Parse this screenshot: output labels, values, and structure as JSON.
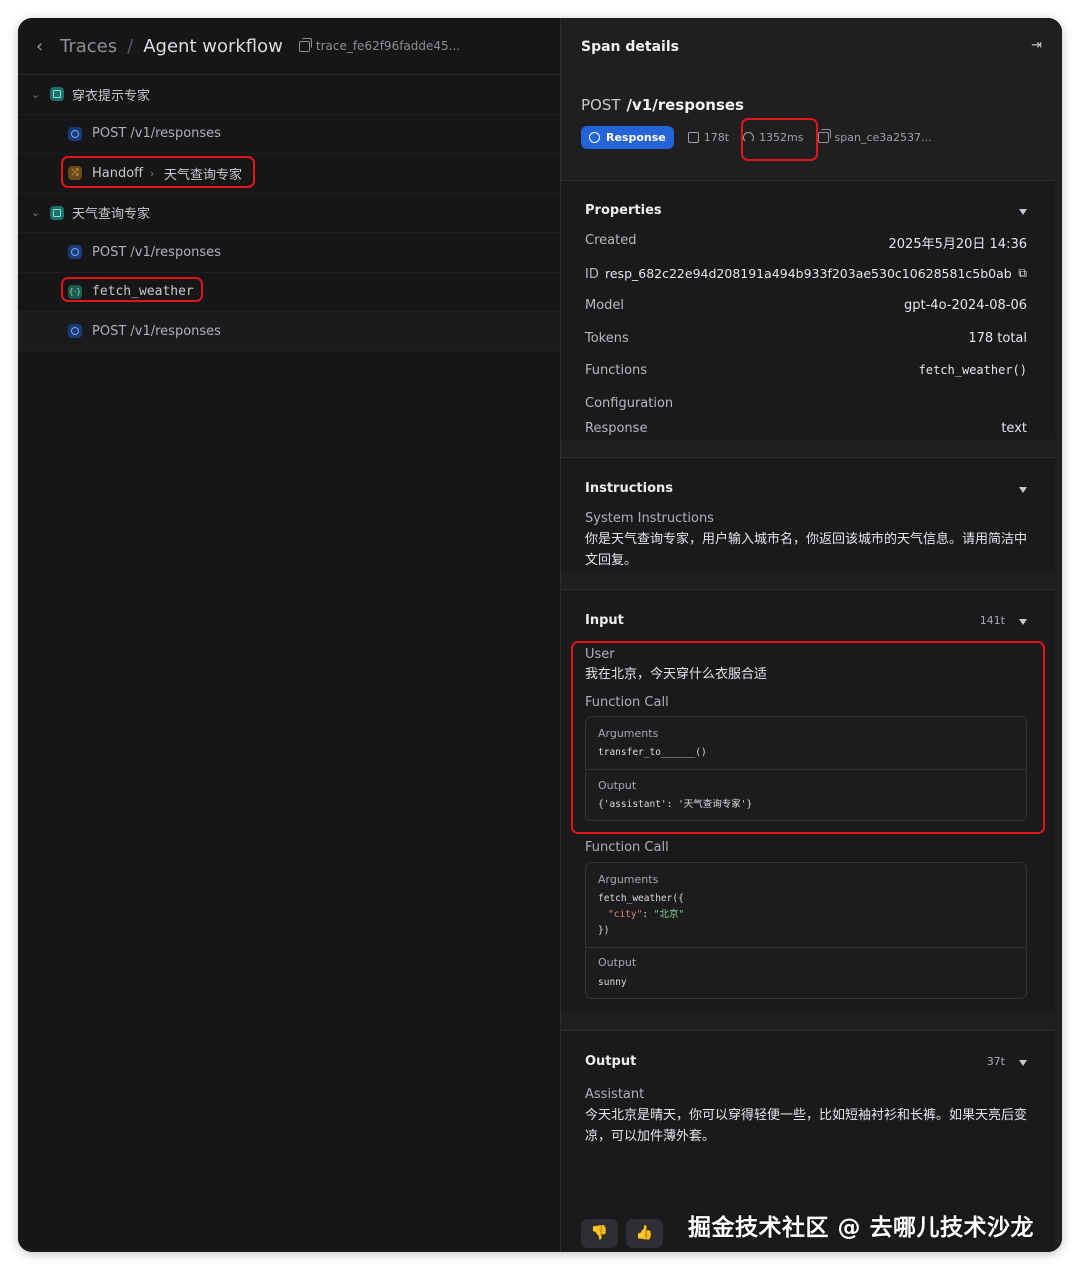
{
  "header": {
    "breadcrumb_root": "Traces",
    "breadcrumb_sep": "/",
    "breadcrumb_current": "Agent workflow",
    "trace_id": "trace_fe62f96fadde45..."
  },
  "tree": [
    {
      "type": "agent",
      "label": "穿衣提示专家"
    },
    {
      "type": "response",
      "label": "POST /v1/responses"
    },
    {
      "type": "handoff",
      "label_from": "Handoff",
      "arrow": "›",
      "label_to": "天气查询专家"
    },
    {
      "type": "agent",
      "label": "天气查询专家"
    },
    {
      "type": "response",
      "label": "POST /v1/responses"
    },
    {
      "type": "function",
      "label": "fetch_weather"
    },
    {
      "type": "response",
      "label": "POST /v1/responses"
    }
  ],
  "span": {
    "title": "Span details",
    "method": "POST",
    "path": "/v1/responses",
    "badge": "Response",
    "tokens": "178t",
    "duration": "1352ms",
    "span_id": "span_ce3a2537..."
  },
  "properties": {
    "title": "Properties",
    "created_label": "Created",
    "created_value": "2025年5月20日 14:36",
    "id_label": "ID",
    "id_value": "resp_682c22e94d208191a494b933f203ae530c10628581c5b0ab",
    "model_label": "Model",
    "model_value": "gpt-4o-2024-08-06",
    "tokens_label": "Tokens",
    "tokens_value": "178 total",
    "functions_label": "Functions",
    "functions_value": "fetch_weather()",
    "config_label": "Configuration",
    "response_label": "Response",
    "response_value": "text"
  },
  "instructions": {
    "title": "Instructions",
    "sub": "System Instructions",
    "text": "你是天气查询专家，用户输入城市名，你返回该城市的天气信息。请用简洁中文回复。"
  },
  "input": {
    "title": "Input",
    "tokens": "141t",
    "user_label": "User",
    "user_text": "我在北京，今天穿什么衣服合适",
    "fc1_label": "Function Call",
    "fc1_args_label": "Arguments",
    "fc1_args": "transfer_to______()",
    "fc1_output_label": "Output",
    "fc1_output": "{'assistant': '天气查询专家'}",
    "fc2_label": "Function Call",
    "fc2_args_label": "Arguments",
    "fc2_args_line1": "fetch_weather({",
    "fc2_args_key": "\"city\"",
    "fc2_args_colon": ": ",
    "fc2_args_val": "\"北京\"",
    "fc2_args_line3": "})",
    "fc2_output_label": "Output",
    "fc2_output": "sunny"
  },
  "output": {
    "title": "Output",
    "tokens": "37t",
    "role": "Assistant",
    "text": "今天北京是晴天，你可以穿得轻便一些，比如短袖衬衫和长裤。如果天亮后变凉，可以加件薄外套。"
  },
  "feedback": {
    "down": "👎",
    "up": "👍"
  },
  "watermark": "掘金技术社区 @ 去哪儿技术沙龙",
  "colors": {
    "accent": "#2563d9",
    "highlight": "#e0161e",
    "bg": "#161618"
  }
}
